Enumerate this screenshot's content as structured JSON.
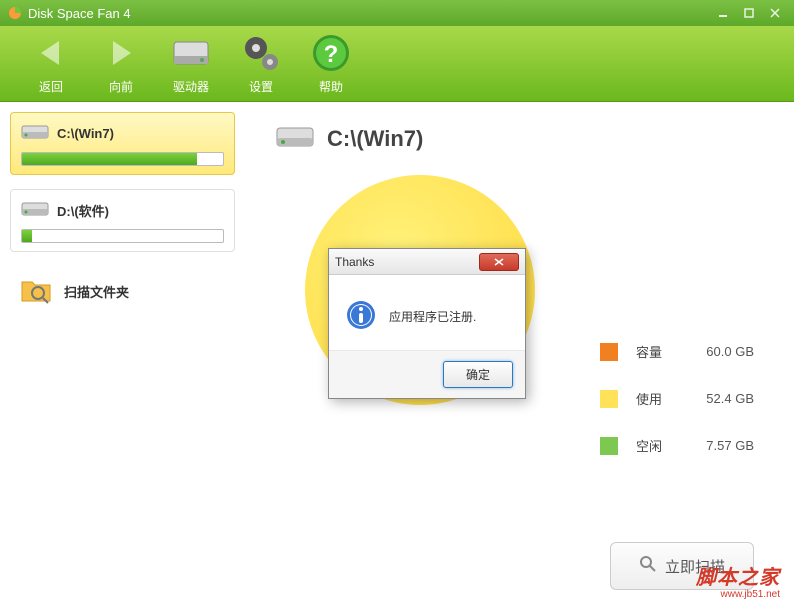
{
  "app": {
    "title": "Disk Space Fan 4"
  },
  "toolbar": {
    "back": "返回",
    "forward": "向前",
    "drives": "驱动器",
    "settings": "设置",
    "help": "帮助"
  },
  "sidebar": {
    "drives": [
      {
        "label": "C:\\(Win7)",
        "percent": 87,
        "active": true
      },
      {
        "label": "D:\\(软件)",
        "percent": 5,
        "active": false
      }
    ],
    "scan_folder": "扫描文件夹"
  },
  "main": {
    "title": "C:\\(Win7)",
    "legend": [
      {
        "label": "容量",
        "value": "60.0 GB",
        "color": "#f08020"
      },
      {
        "label": "使用",
        "value": "52.4 GB",
        "color": "#ffe25a"
      },
      {
        "label": "空闲",
        "value": "7.57 GB",
        "color": "#7cc850"
      }
    ],
    "scan_now": "立即扫描"
  },
  "dialog": {
    "title": "Thanks",
    "message": "应用程序已注册.",
    "ok": "确定"
  },
  "chart_data": {
    "type": "pie",
    "title": "C:\\(Win7)",
    "series": [
      {
        "name": "使用",
        "value": 52.4,
        "unit": "GB",
        "color": "#ffe25a"
      },
      {
        "name": "空闲",
        "value": 7.57,
        "unit": "GB",
        "color": "#7cc850"
      }
    ],
    "total": {
      "name": "容量",
      "value": 60.0,
      "unit": "GB",
      "color": "#f08020"
    }
  },
  "watermark": {
    "text": "脚本之家",
    "url": "www.jb51.net"
  }
}
